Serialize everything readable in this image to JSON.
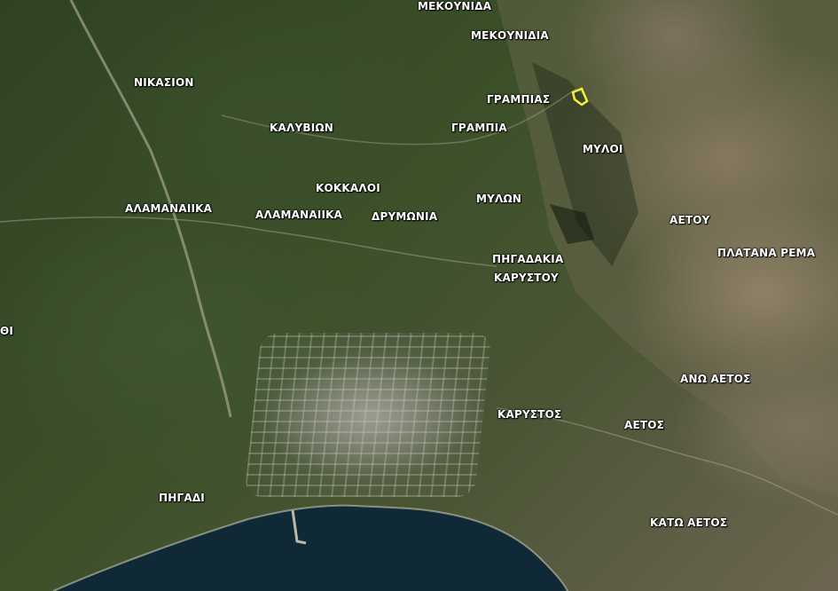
{
  "map": {
    "labels": {
      "mekounida": "ΜΕΚΟΥΝΙΔΑ",
      "mekounidia": "ΜΕΚΟΥΝΙΔΙΑ",
      "nikasion": "ΝΙΚΑΣΙΟΝ",
      "grampias": "ΓΡΑΜΠΙΑΣ",
      "kalyvion": "ΚΑΛΥΒΙΩΝ",
      "grampia": "ΓΡΑΜΠΙΑ",
      "myloi": "ΜΥΛΟΙ",
      "kokkaloi": "ΚΟΚΚΑΛΟΙ",
      "alamanaiika_west": "ΑΛΑΜΑΝΑΙΙΚΑ",
      "alamanaiika_east": "ΑΛΑΜΑΝΑΙΙΚΑ",
      "drymonia": "ΔΡΥΜΩΝΙΑ",
      "mylon": "ΜΥΛΩΝ",
      "aetou": "ΑΕΤΟΥ",
      "platana_rema": "ΠΛΑΤΑΝΑ ΡΕΜΑ",
      "pigadakia": "ΠΗΓΑΔΑΚΙΑ",
      "karystou": "ΚΑΡΥΣΤΟΥ",
      "partial_edge": "ΘΙ",
      "ano_aetos": "ΑΝΩ ΑΕΤΟΣ",
      "karystos": "ΚΑΡΥΣΤΟΣ",
      "aetos": "ΑΕΤΟΣ",
      "pigadi": "ΠΗΓΑΔΙ",
      "kato_aetos": "ΚΑΤΩ ΑΕΤΟΣ"
    },
    "colors": {
      "sea": "#0f2a36",
      "highlight_outline": "#f2f23a",
      "label_text": "#ffffff"
    }
  }
}
